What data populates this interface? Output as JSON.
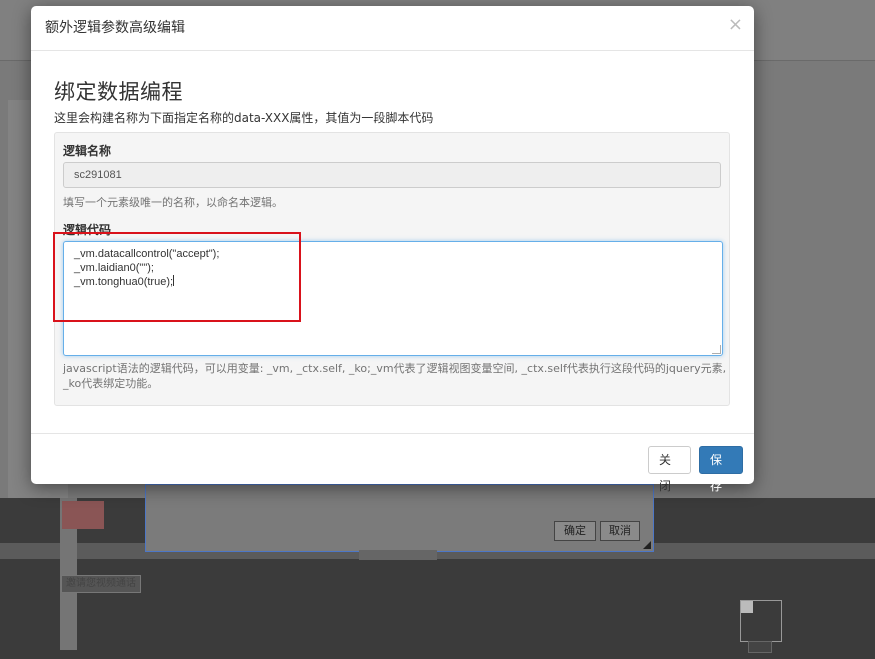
{
  "background": {
    "confirm_label": "确定",
    "cancel_label": "取消",
    "video_tag": "邀请您视频通话"
  },
  "modal": {
    "title": "额外逻辑参数高级编辑",
    "close_glyph": "×",
    "section_title": "绑定数据编程",
    "section_desc": "这里会构建名称为下面指定名称的data-XXX属性，其值为一段脚本代码",
    "name_label": "逻辑名称",
    "name_value": "sc291081",
    "name_help": "填写一个元素级唯一的名称，以命名本逻辑。",
    "code_label": "逻辑代码",
    "code_lines": [
      "_vm.datacallcontrol(\"accept\");",
      "_vm.laidian0(\"\");",
      "_vm.tonghua0(true);"
    ],
    "code_help": "javascript语法的逻辑代码，可以用变量: _vm, _ctx.self, _ko;_vm代表了逻辑视图变量空间, _ctx.self代表执行这段代码的jquery元素, _ko代表绑定功能。",
    "close_button": "关闭",
    "save_button": "保存"
  },
  "colors": {
    "primary": "#337ab7",
    "highlight": "#d9121b",
    "focus_border": "#66afe9"
  }
}
